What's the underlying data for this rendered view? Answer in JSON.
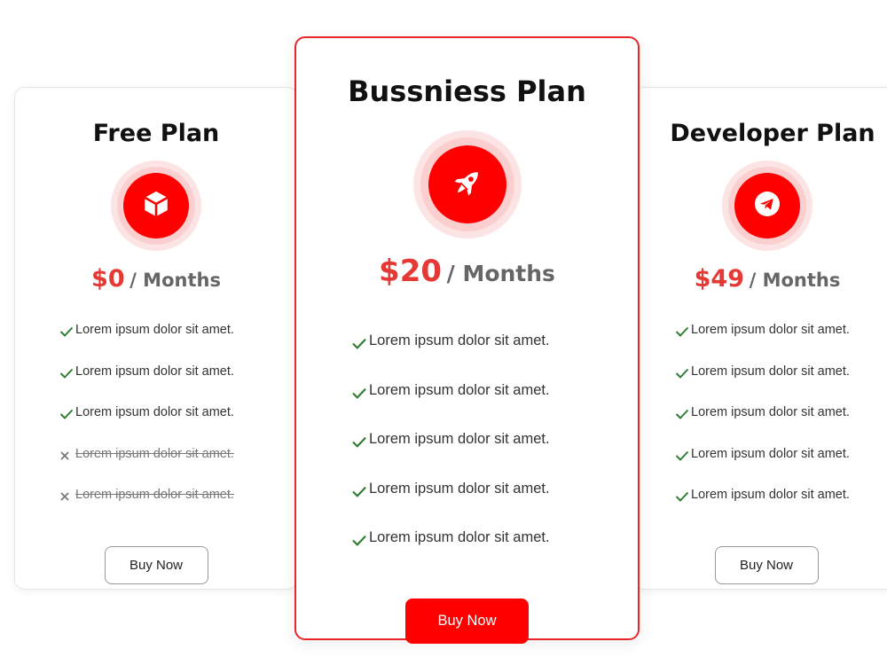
{
  "plans": {
    "free": {
      "title": "Free Plan",
      "icon": "cube-icon",
      "price": "$0",
      "period": "/ Months",
      "features": [
        {
          "text": "Lorem ipsum dolor sit amet.",
          "included": true
        },
        {
          "text": "Lorem ipsum dolor sit amet.",
          "included": true
        },
        {
          "text": "Lorem ipsum dolor sit amet.",
          "included": true
        },
        {
          "text": "Lorem ipsum dolor sit amet.",
          "included": false
        },
        {
          "text": "Lorem ipsum dolor sit amet.",
          "included": false
        }
      ],
      "button": "Buy Now"
    },
    "business": {
      "title": "Bussniess Plan",
      "icon": "rocket-icon",
      "price": "$20",
      "period": "/ Months",
      "features": [
        {
          "text": "Lorem ipsum dolor sit amet.",
          "included": true
        },
        {
          "text": "Lorem ipsum dolor sit amet.",
          "included": true
        },
        {
          "text": "Lorem ipsum dolor sit amet.",
          "included": true
        },
        {
          "text": "Lorem ipsum dolor sit amet.",
          "included": true
        },
        {
          "text": "Lorem ipsum dolor sit amet.",
          "included": true
        }
      ],
      "button": "Buy Now"
    },
    "developer": {
      "title": "Developer Plan",
      "icon": "telegram-icon",
      "price": "$49",
      "period": "/ Months",
      "features": [
        {
          "text": "Lorem ipsum dolor sit amet.",
          "included": true
        },
        {
          "text": "Lorem ipsum dolor sit amet.",
          "included": true
        },
        {
          "text": "Lorem ipsum dolor sit amet.",
          "included": true
        },
        {
          "text": "Lorem ipsum dolor sit amet.",
          "included": true
        },
        {
          "text": "Lorem ipsum dolor sit amet.",
          "included": true
        }
      ],
      "button": "Buy Now"
    }
  },
  "colors": {
    "accent": "#ff0000",
    "price": "#e53935",
    "check": "#2e7d32",
    "cross": "#777777"
  }
}
